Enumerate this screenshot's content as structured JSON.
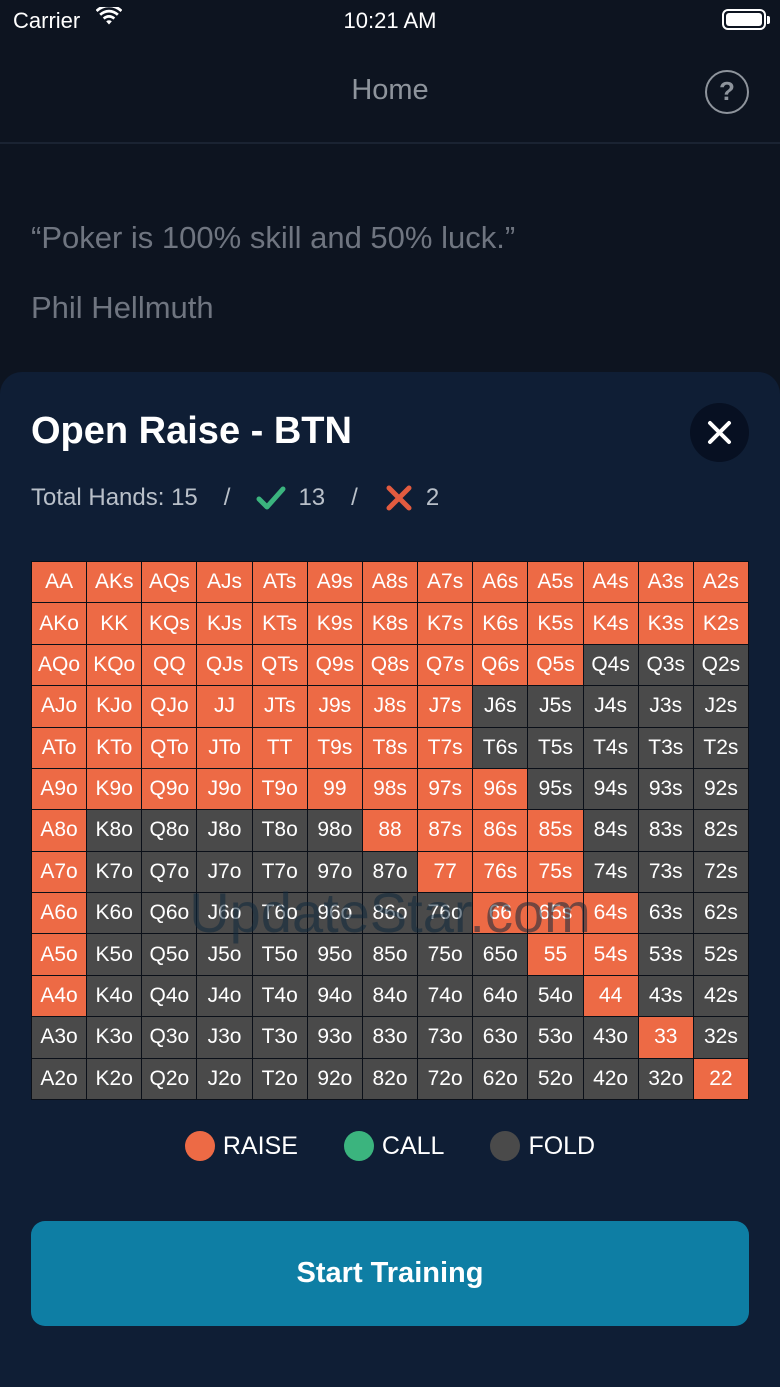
{
  "status_bar": {
    "carrier": "Carrier",
    "time": "10:21 AM"
  },
  "nav": {
    "title": "Home",
    "help_icon": "?"
  },
  "quote": {
    "text": "“Poker is 100% skill and 50% luck.”",
    "author": "Phil Hellmuth"
  },
  "sheet": {
    "title": "Open Raise - BTN",
    "stats": {
      "total_label": "Total Hands: 15",
      "separator": "/",
      "correct": "13",
      "wrong": "2"
    }
  },
  "colors": {
    "raise": "#ed6a45",
    "call": "#3bb47e",
    "fold": "#4a4a4a",
    "button": "#0e7ea4"
  },
  "grid": [
    [
      [
        "AA",
        "r"
      ],
      [
        "AKs",
        "r"
      ],
      [
        "AQs",
        "r"
      ],
      [
        "AJs",
        "r"
      ],
      [
        "ATs",
        "r"
      ],
      [
        "A9s",
        "r"
      ],
      [
        "A8s",
        "r"
      ],
      [
        "A7s",
        "r"
      ],
      [
        "A6s",
        "r"
      ],
      [
        "A5s",
        "r"
      ],
      [
        "A4s",
        "r"
      ],
      [
        "A3s",
        "r"
      ],
      [
        "A2s",
        "r"
      ]
    ],
    [
      [
        "AKo",
        "r"
      ],
      [
        "KK",
        "r"
      ],
      [
        "KQs",
        "r"
      ],
      [
        "KJs",
        "r"
      ],
      [
        "KTs",
        "r"
      ],
      [
        "K9s",
        "r"
      ],
      [
        "K8s",
        "r"
      ],
      [
        "K7s",
        "r"
      ],
      [
        "K6s",
        "r"
      ],
      [
        "K5s",
        "r"
      ],
      [
        "K4s",
        "r"
      ],
      [
        "K3s",
        "r"
      ],
      [
        "K2s",
        "r"
      ]
    ],
    [
      [
        "AQo",
        "r"
      ],
      [
        "KQo",
        "r"
      ],
      [
        "QQ",
        "r"
      ],
      [
        "QJs",
        "r"
      ],
      [
        "QTs",
        "r"
      ],
      [
        "Q9s",
        "r"
      ],
      [
        "Q8s",
        "r"
      ],
      [
        "Q7s",
        "r"
      ],
      [
        "Q6s",
        "r"
      ],
      [
        "Q5s",
        "r"
      ],
      [
        "Q4s",
        "f"
      ],
      [
        "Q3s",
        "f"
      ],
      [
        "Q2s",
        "f"
      ]
    ],
    [
      [
        "AJo",
        "r"
      ],
      [
        "KJo",
        "r"
      ],
      [
        "QJo",
        "r"
      ],
      [
        "JJ",
        "r"
      ],
      [
        "JTs",
        "r"
      ],
      [
        "J9s",
        "r"
      ],
      [
        "J8s",
        "r"
      ],
      [
        "J7s",
        "r"
      ],
      [
        "J6s",
        "f"
      ],
      [
        "J5s",
        "f"
      ],
      [
        "J4s",
        "f"
      ],
      [
        "J3s",
        "f"
      ],
      [
        "J2s",
        "f"
      ]
    ],
    [
      [
        "ATo",
        "r"
      ],
      [
        "KTo",
        "r"
      ],
      [
        "QTo",
        "r"
      ],
      [
        "JTo",
        "r"
      ],
      [
        "TT",
        "r"
      ],
      [
        "T9s",
        "r"
      ],
      [
        "T8s",
        "r"
      ],
      [
        "T7s",
        "r"
      ],
      [
        "T6s",
        "f"
      ],
      [
        "T5s",
        "f"
      ],
      [
        "T4s",
        "f"
      ],
      [
        "T3s",
        "f"
      ],
      [
        "T2s",
        "f"
      ]
    ],
    [
      [
        "A9o",
        "r"
      ],
      [
        "K9o",
        "r"
      ],
      [
        "Q9o",
        "r"
      ],
      [
        "J9o",
        "r"
      ],
      [
        "T9o",
        "r"
      ],
      [
        "99",
        "r"
      ],
      [
        "98s",
        "r"
      ],
      [
        "97s",
        "r"
      ],
      [
        "96s",
        "r"
      ],
      [
        "95s",
        "f"
      ],
      [
        "94s",
        "f"
      ],
      [
        "93s",
        "f"
      ],
      [
        "92s",
        "f"
      ]
    ],
    [
      [
        "A8o",
        "r"
      ],
      [
        "K8o",
        "f"
      ],
      [
        "Q8o",
        "f"
      ],
      [
        "J8o",
        "f"
      ],
      [
        "T8o",
        "f"
      ],
      [
        "98o",
        "f"
      ],
      [
        "88",
        "r"
      ],
      [
        "87s",
        "r"
      ],
      [
        "86s",
        "r"
      ],
      [
        "85s",
        "r"
      ],
      [
        "84s",
        "f"
      ],
      [
        "83s",
        "f"
      ],
      [
        "82s",
        "f"
      ]
    ],
    [
      [
        "A7o",
        "r"
      ],
      [
        "K7o",
        "f"
      ],
      [
        "Q7o",
        "f"
      ],
      [
        "J7o",
        "f"
      ],
      [
        "T7o",
        "f"
      ],
      [
        "97o",
        "f"
      ],
      [
        "87o",
        "f"
      ],
      [
        "77",
        "r"
      ],
      [
        "76s",
        "r"
      ],
      [
        "75s",
        "r"
      ],
      [
        "74s",
        "f"
      ],
      [
        "73s",
        "f"
      ],
      [
        "72s",
        "f"
      ]
    ],
    [
      [
        "A6o",
        "r"
      ],
      [
        "K6o",
        "f"
      ],
      [
        "Q6o",
        "f"
      ],
      [
        "J6o",
        "f"
      ],
      [
        "T6o",
        "f"
      ],
      [
        "96o",
        "f"
      ],
      [
        "86o",
        "f"
      ],
      [
        "76o",
        "f"
      ],
      [
        "66",
        "r"
      ],
      [
        "65s",
        "r"
      ],
      [
        "64s",
        "r"
      ],
      [
        "63s",
        "f"
      ],
      [
        "62s",
        "f"
      ]
    ],
    [
      [
        "A5o",
        "r"
      ],
      [
        "K5o",
        "f"
      ],
      [
        "Q5o",
        "f"
      ],
      [
        "J5o",
        "f"
      ],
      [
        "T5o",
        "f"
      ],
      [
        "95o",
        "f"
      ],
      [
        "85o",
        "f"
      ],
      [
        "75o",
        "f"
      ],
      [
        "65o",
        "f"
      ],
      [
        "55",
        "r"
      ],
      [
        "54s",
        "r"
      ],
      [
        "53s",
        "f"
      ],
      [
        "52s",
        "f"
      ]
    ],
    [
      [
        "A4o",
        "r"
      ],
      [
        "K4o",
        "f"
      ],
      [
        "Q4o",
        "f"
      ],
      [
        "J4o",
        "f"
      ],
      [
        "T4o",
        "f"
      ],
      [
        "94o",
        "f"
      ],
      [
        "84o",
        "f"
      ],
      [
        "74o",
        "f"
      ],
      [
        "64o",
        "f"
      ],
      [
        "54o",
        "f"
      ],
      [
        "44",
        "r"
      ],
      [
        "43s",
        "f"
      ],
      [
        "42s",
        "f"
      ]
    ],
    [
      [
        "A3o",
        "f"
      ],
      [
        "K3o",
        "f"
      ],
      [
        "Q3o",
        "f"
      ],
      [
        "J3o",
        "f"
      ],
      [
        "T3o",
        "f"
      ],
      [
        "93o",
        "f"
      ],
      [
        "83o",
        "f"
      ],
      [
        "73o",
        "f"
      ],
      [
        "63o",
        "f"
      ],
      [
        "53o",
        "f"
      ],
      [
        "43o",
        "f"
      ],
      [
        "33",
        "r"
      ],
      [
        "32s",
        "f"
      ]
    ],
    [
      [
        "A2o",
        "f"
      ],
      [
        "K2o",
        "f"
      ],
      [
        "Q2o",
        "f"
      ],
      [
        "J2o",
        "f"
      ],
      [
        "T2o",
        "f"
      ],
      [
        "92o",
        "f"
      ],
      [
        "82o",
        "f"
      ],
      [
        "72o",
        "f"
      ],
      [
        "62o",
        "f"
      ],
      [
        "52o",
        "f"
      ],
      [
        "42o",
        "f"
      ],
      [
        "32o",
        "f"
      ],
      [
        "22",
        "r"
      ]
    ]
  ],
  "legend": {
    "raise": "RAISE",
    "call": "CALL",
    "fold": "FOLD"
  },
  "button": {
    "label": "Start Training"
  },
  "watermark": "UpdateStar.com"
}
